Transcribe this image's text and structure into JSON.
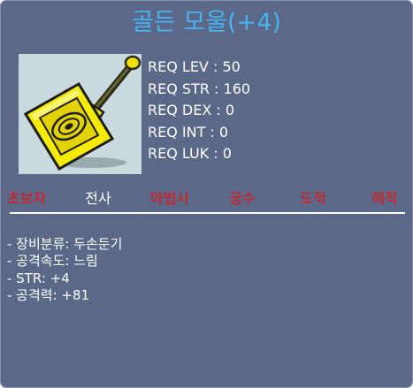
{
  "item": {
    "name": "골든 모울(+4)",
    "title_color": "#44b5f2",
    "icon": "golden-mallet-icon"
  },
  "requirements": [
    "REQ LEV : 50",
    "REQ STR : 160",
    "REQ DEX : 0",
    "REQ INT : 0",
    "REQ LUK : 0"
  ],
  "jobs": [
    {
      "label": "초보자",
      "allowed": false
    },
    {
      "label": "전사",
      "allowed": true
    },
    {
      "label": "마법사",
      "allowed": false
    },
    {
      "label": "궁수",
      "allowed": false
    },
    {
      "label": "도적",
      "allowed": false
    },
    {
      "label": "해적",
      "allowed": false
    }
  ],
  "stats": [
    "- 장비분류: 두손둔기",
    "- 공격속도: 느림",
    "- STR: +4",
    "- 공격력: +81"
  ],
  "colors": {
    "background": "#5b6887",
    "job_denied": "#ee1111",
    "job_allowed": "#ffffff"
  }
}
